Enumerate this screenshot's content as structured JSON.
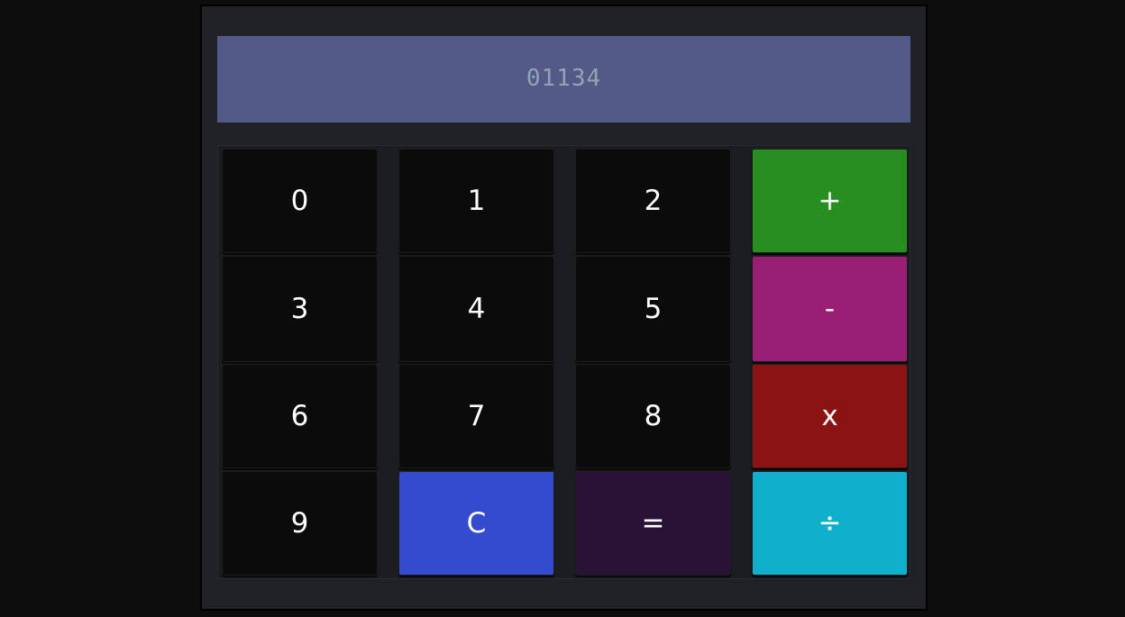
{
  "display": {
    "value": "01134"
  },
  "keys": {
    "k0": "0",
    "k1": "1",
    "k2": "2",
    "plus": "+",
    "k3": "3",
    "k4": "4",
    "k5": "5",
    "minus": "-",
    "k6": "6",
    "k7": "7",
    "k8": "8",
    "multiply": "x",
    "k9": "9",
    "clear": "C",
    "equals": "=",
    "divide": "÷"
  },
  "colors": {
    "plus": "#278f1f",
    "minus": "#991f75",
    "multiply": "#8c1313",
    "divide": "#10b0cd",
    "clear": "#344bcf",
    "equals": "#2a1237",
    "number": "#0b0b0b",
    "display": "#535a87"
  }
}
